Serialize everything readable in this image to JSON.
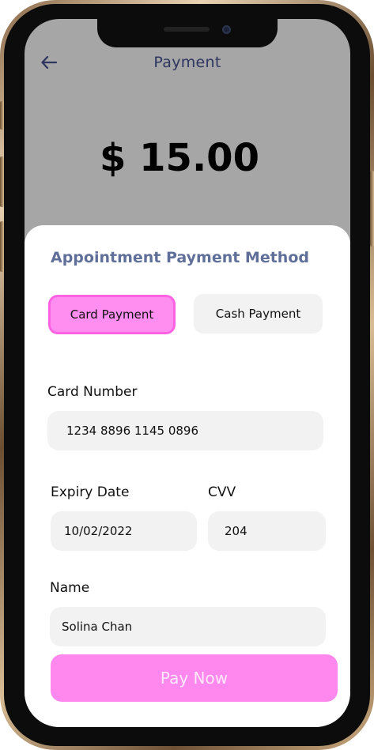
{
  "header": {
    "title": "Payment",
    "back_icon": "arrow-left-icon"
  },
  "amount": "$ 15.00",
  "form": {
    "section_title": "Appointment Payment Method",
    "methods": {
      "card_label": "Card Payment",
      "cash_label": "Cash Payment",
      "selected": "Card Payment"
    },
    "card_number": {
      "label": "Card Number",
      "value": "1234 8896 1145 0896"
    },
    "expiry": {
      "label": "Expiry Date",
      "value": "10/02/2022"
    },
    "cvv": {
      "label": "CVV",
      "value": "204"
    },
    "name": {
      "label": "Name",
      "value": "Solina Chan"
    },
    "submit_label": "Pay Now"
  },
  "colors": {
    "accent": "#ff88ee",
    "accent_border": "#ff63e2",
    "title_navy": "#2e3560",
    "section_title": "#5f6f99",
    "header_bg": "#a6a6a6",
    "field_bg": "#f2f2f2"
  }
}
